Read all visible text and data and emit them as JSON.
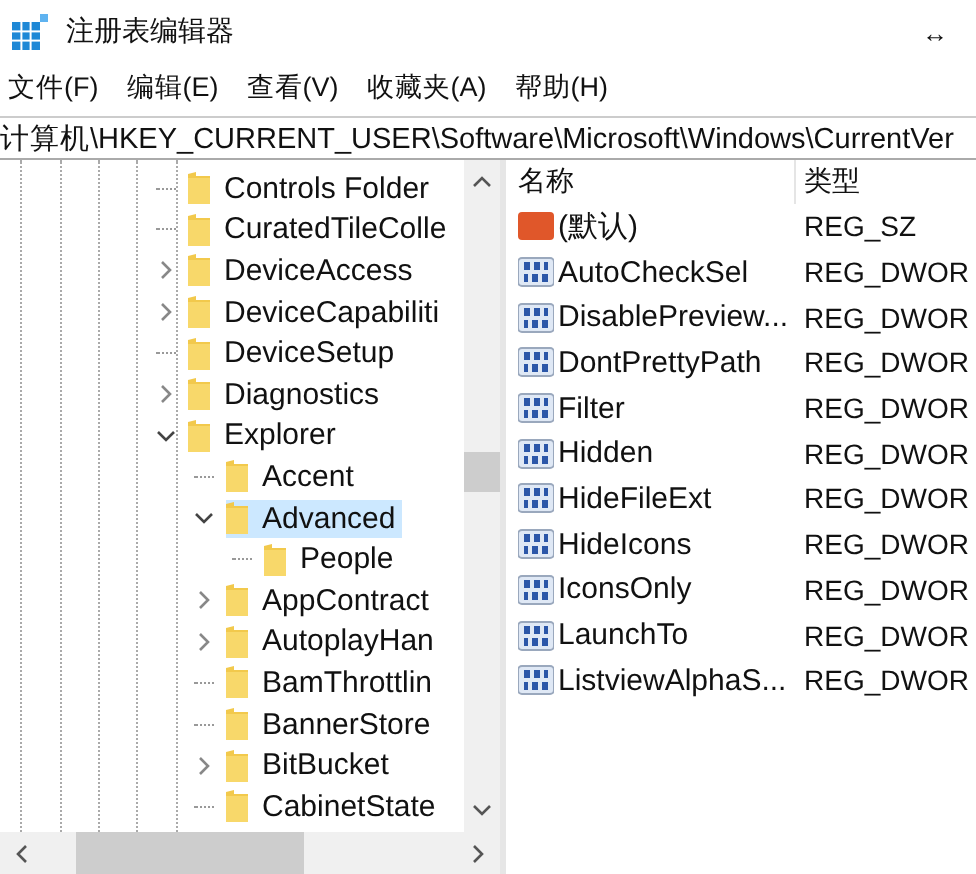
{
  "window": {
    "title": "注册表编辑器",
    "resize_glyph": "↔"
  },
  "menu": [
    "文件(F)",
    "编辑(E)",
    "查看(V)",
    "收藏夹(A)",
    "帮助(H)"
  ],
  "address": "计算机\\HKEY_CURRENT_USER\\Software\\Microsoft\\Windows\\CurrentVer",
  "tree": [
    {
      "label": "Controls Folder",
      "expandable": false,
      "expanded": false,
      "selected": false
    },
    {
      "label": "CuratedTileColle",
      "expandable": false,
      "expanded": false,
      "selected": false
    },
    {
      "label": "DeviceAccess",
      "expandable": true,
      "expanded": false,
      "selected": false
    },
    {
      "label": "DeviceCapabiliti",
      "expandable": true,
      "expanded": false,
      "selected": false
    },
    {
      "label": "DeviceSetup",
      "expandable": false,
      "expanded": false,
      "selected": false
    },
    {
      "label": "Diagnostics",
      "expandable": true,
      "expanded": false,
      "selected": false
    },
    {
      "label": "Explorer",
      "expandable": true,
      "expanded": true,
      "selected": false,
      "children": [
        {
          "label": "Accent",
          "expandable": false,
          "expanded": false,
          "selected": false
        },
        {
          "label": "Advanced",
          "expandable": true,
          "expanded": true,
          "selected": true,
          "children": [
            {
              "label": "People",
              "expandable": false,
              "expanded": false,
              "selected": false
            }
          ]
        },
        {
          "label": "AppContract",
          "expandable": true,
          "expanded": false,
          "selected": false
        },
        {
          "label": "AutoplayHan",
          "expandable": true,
          "expanded": false,
          "selected": false
        },
        {
          "label": "BamThrottlin",
          "expandable": false,
          "expanded": false,
          "selected": false
        },
        {
          "label": "BannerStore",
          "expandable": false,
          "expanded": false,
          "selected": false
        },
        {
          "label": "BitBucket",
          "expandable": true,
          "expanded": false,
          "selected": false
        },
        {
          "label": "CabinetState",
          "expandable": false,
          "expanded": false,
          "selected": false
        }
      ]
    }
  ],
  "values": {
    "columns": [
      "名称",
      "类型"
    ],
    "rows": [
      {
        "kind": "string",
        "name": "(默认)",
        "type": "REG_SZ"
      },
      {
        "kind": "dword",
        "name": "AutoCheckSel",
        "type": "REG_DWOR"
      },
      {
        "kind": "dword",
        "name": "DisablePreview...",
        "type": "REG_DWOR"
      },
      {
        "kind": "dword",
        "name": "DontPrettyPath",
        "type": "REG_DWOR"
      },
      {
        "kind": "dword",
        "name": "Filter",
        "type": "REG_DWOR"
      },
      {
        "kind": "dword",
        "name": "Hidden",
        "type": "REG_DWOR"
      },
      {
        "kind": "dword",
        "name": "HideFileExt",
        "type": "REG_DWOR"
      },
      {
        "kind": "dword",
        "name": "HideIcons",
        "type": "REG_DWOR"
      },
      {
        "kind": "dword",
        "name": "IconsOnly",
        "type": "REG_DWOR"
      },
      {
        "kind": "dword",
        "name": "LaunchTo",
        "type": "REG_DWOR"
      },
      {
        "kind": "dword",
        "name": "ListviewAlphaS...",
        "type": "REG_DWOR"
      }
    ]
  }
}
